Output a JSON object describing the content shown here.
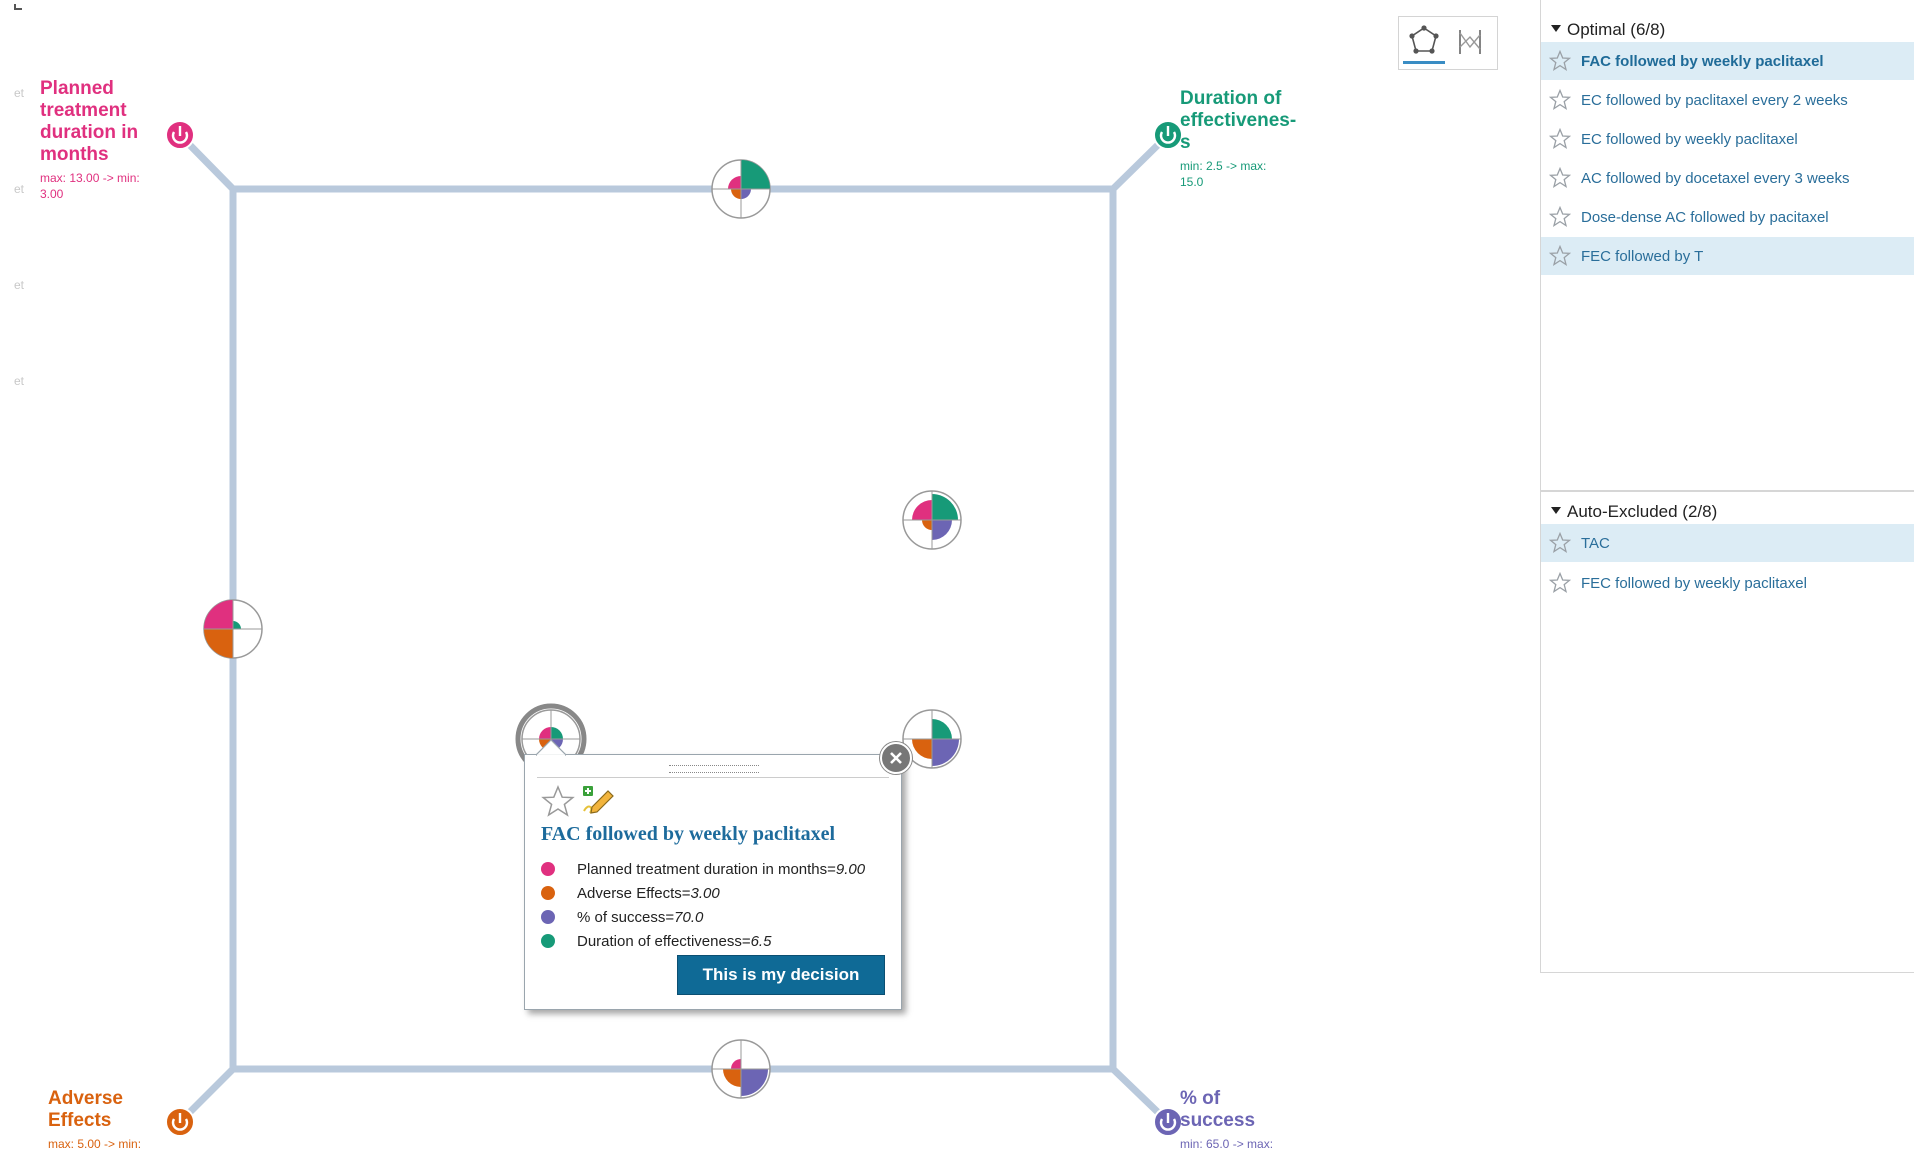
{
  "left_faint_labels": [
    "et",
    "et",
    "et",
    "et"
  ],
  "axes": {
    "top_left": {
      "name": "Planned treatment duration in months",
      "name_lines": [
        "Planned",
        "treatment",
        "duration in",
        "months"
      ],
      "range": "max: 13.00 -> min: 3.00",
      "range_lines": [
        "max: 13.00 -> min:",
        "3.00"
      ],
      "color": "#e0307f"
    },
    "top_right": {
      "name": "Duration of effectiveness",
      "name_lines": [
        "Duration of",
        "effectivenes-",
        "s"
      ],
      "range": "min: 2.5 -> max: 15.0",
      "range_lines": [
        "min: 2.5 -> max:",
        "15.0"
      ],
      "color": "#179a78"
    },
    "bottom_left": {
      "name": "Adverse Effects",
      "name_lines": [
        "Adverse",
        "Effects"
      ],
      "range": "max: 5.00 -> min:",
      "range_lines": [
        "max: 5.00 -> min:"
      ],
      "color": "#d9620f"
    },
    "bottom_right": {
      "name": "% of success",
      "name_lines": [
        "% of",
        "success"
      ],
      "range": "min: 65.0 -> max:",
      "range_lines": [
        "min: 65.0 -> max:"
      ],
      "color": "#6c65b4"
    }
  },
  "toolbar": {
    "buttons": [
      "network-view",
      "parallel-coordinates-view"
    ],
    "active": "network-view"
  },
  "panel": {
    "optimal": {
      "header": "Optimal (6/8)",
      "items": [
        {
          "label": "FAC followed by weekly paclitaxel",
          "selected": true,
          "bold": true
        },
        {
          "label": "EC followed by paclitaxel every 2 weeks",
          "selected": false,
          "bold": false
        },
        {
          "label": "EC followed by weekly paclitaxel",
          "selected": false,
          "bold": false
        },
        {
          "label": "AC followed by docetaxel every 3 weeks",
          "selected": false,
          "bold": false
        },
        {
          "label": "Dose-dense AC followed by pacitaxel",
          "selected": false,
          "bold": false
        },
        {
          "label": "FEC followed by T",
          "selected": true,
          "bold": false
        }
      ]
    },
    "excluded": {
      "header": "Auto-Excluded (2/8)",
      "items": [
        {
          "label": "TAC",
          "selected": true,
          "bold": false
        },
        {
          "label": "FEC followed by weekly paclitaxel",
          "selected": false,
          "bold": false
        }
      ]
    }
  },
  "popup": {
    "title": "FAC followed by weekly paclitaxel",
    "attributes": [
      {
        "label": "Planned treatment duration in months=",
        "value": "9.00",
        "color": "#e0307f"
      },
      {
        "label": "Adverse Effects=",
        "value": "3.00",
        "color": "#d9620f"
      },
      {
        "label": "% of success=",
        "value": "70.0",
        "color": "#6c65b4"
      },
      {
        "label": "Duration of effectiveness=",
        "value": "6.5",
        "color": "#179a78"
      }
    ],
    "decision_button": "This is my decision"
  }
}
